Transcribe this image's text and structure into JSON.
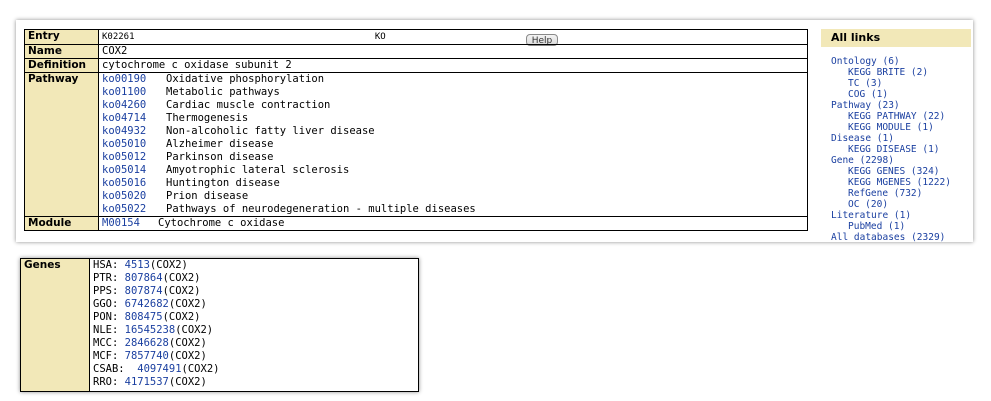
{
  "help_label": "Help",
  "entry": {
    "label": "Entry",
    "id": "K02261",
    "type": "KO"
  },
  "name": {
    "label": "Name",
    "value": "COX2"
  },
  "definition": {
    "label": "Definition",
    "value": "cytochrome c oxidase subunit 2"
  },
  "pathway": {
    "label": "Pathway",
    "items": [
      {
        "code": "ko00190",
        "desc": "Oxidative phosphorylation"
      },
      {
        "code": "ko01100",
        "desc": "Metabolic pathways"
      },
      {
        "code": "ko04260",
        "desc": "Cardiac muscle contraction"
      },
      {
        "code": "ko04714",
        "desc": "Thermogenesis"
      },
      {
        "code": "ko04932",
        "desc": "Non-alcoholic fatty liver disease"
      },
      {
        "code": "ko05010",
        "desc": "Alzheimer disease"
      },
      {
        "code": "ko05012",
        "desc": "Parkinson disease"
      },
      {
        "code": "ko05014",
        "desc": "Amyotrophic lateral sclerosis"
      },
      {
        "code": "ko05016",
        "desc": "Huntington disease"
      },
      {
        "code": "ko05020",
        "desc": "Prion disease"
      },
      {
        "code": "ko05022",
        "desc": "Pathways of neurodegeneration - multiple diseases"
      }
    ]
  },
  "module": {
    "label": "Module",
    "code": "M00154",
    "desc": "Cytochrome c oxidase"
  },
  "all_links": {
    "title": "All links",
    "items": [
      {
        "text": "Ontology (6)",
        "level": 0
      },
      {
        "text": "KEGG BRITE (2)",
        "level": 1
      },
      {
        "text": "TC (3)",
        "level": 1
      },
      {
        "text": "COG (1)",
        "level": 1
      },
      {
        "text": "Pathway (23)",
        "level": 0
      },
      {
        "text": "KEGG PATHWAY (22)",
        "level": 1
      },
      {
        "text": "KEGG MODULE (1)",
        "level": 1
      },
      {
        "text": "Disease (1)",
        "level": 0
      },
      {
        "text": "KEGG DISEASE (1)",
        "level": 1
      },
      {
        "text": "Gene (2298)",
        "level": 0
      },
      {
        "text": "KEGG GENES (324)",
        "level": 1
      },
      {
        "text": "KEGG MGENES (1222)",
        "level": 1
      },
      {
        "text": "RefGene (732)",
        "level": 1
      },
      {
        "text": "OC (20)",
        "level": 1
      },
      {
        "text": "Literature (1)",
        "level": 0
      },
      {
        "text": "PubMed (1)",
        "level": 1
      },
      {
        "text": "All databases (2329)",
        "level": 0
      }
    ]
  },
  "genes": {
    "label": "Genes",
    "items": [
      {
        "org": "HSA:",
        "gap": " ",
        "id": "4513",
        "sym": "(COX2)"
      },
      {
        "org": "PTR:",
        "gap": " ",
        "id": "807864",
        "sym": "(COX2)"
      },
      {
        "org": "PPS:",
        "gap": " ",
        "id": "807874",
        "sym": "(COX2)"
      },
      {
        "org": "GGO:",
        "gap": " ",
        "id": "6742682",
        "sym": "(COX2)"
      },
      {
        "org": "PON:",
        "gap": " ",
        "id": "808475",
        "sym": "(COX2)"
      },
      {
        "org": "NLE:",
        "gap": " ",
        "id": "16545238",
        "sym": "(COX2)"
      },
      {
        "org": "MCC:",
        "gap": " ",
        "id": "2846628",
        "sym": "(COX2)"
      },
      {
        "org": "MCF:",
        "gap": " ",
        "id": "7857740",
        "sym": "(COX2)"
      },
      {
        "org": "CSAB:",
        "gap": "  ",
        "id": "4097491",
        "sym": "(COX2)"
      },
      {
        "org": "RRO:",
        "gap": " ",
        "id": "4171537",
        "sym": "(COX2)"
      }
    ]
  }
}
